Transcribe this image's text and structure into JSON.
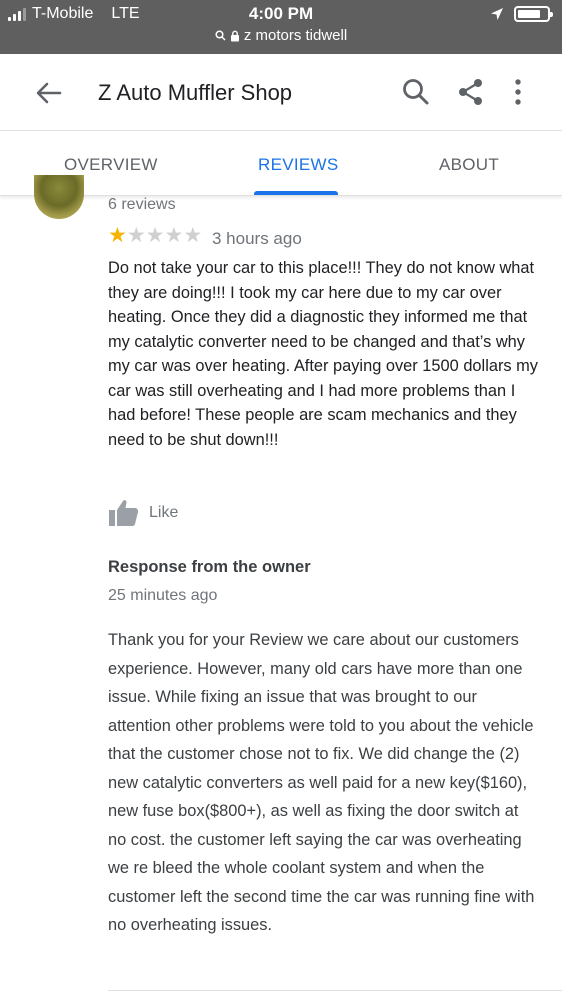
{
  "status_bar": {
    "carrier": "T-Mobile",
    "network": "LTE",
    "time": "4:00 PM",
    "url": "z motors tidwell",
    "battery_level": 0.8
  },
  "app_bar": {
    "title": "Z Auto Muffler Shop"
  },
  "tabs": [
    {
      "label": "OVERVIEW",
      "active": false
    },
    {
      "label": "REVIEWS",
      "active": true
    },
    {
      "label": "ABOUT",
      "active": false
    }
  ],
  "review": {
    "review_count": "6 reviews",
    "rating": 1,
    "max_rating": 5,
    "time": "3 hours ago",
    "text": "Do not take your car to this place!!! They do not know what they are doing!!! I took my car here due to my car over heating. Once they did a diagnostic they informed me that my catalytic converter need to be changed and that’s why my car was over heating. After paying over 1500 dollars my car was still overheating and I had more problems than I had before! These people are scam mechanics and they need to be shut down!!!",
    "like_label": "Like"
  },
  "owner_response": {
    "title": "Response from the owner",
    "time": "25 minutes ago",
    "text": "Thank you for your Review we care about our customers experience. However, many old cars have more than one issue. While fixing an issue that was brought to our attention other problems were told to you about the vehicle that the customer chose not to fix. We did change the (2) new catalytic converters as well paid for a new key($160), new fuse box($800+), as well as fixing the door switch at no cost. the customer left saying the car was overheating we re bleed the whole coolant system and when the customer left the second time the car was running fine with no overheating issues."
  },
  "colors": {
    "accent": "#1a73e8",
    "star": "#f4b400",
    "status_bar": "#5f5f5f"
  }
}
